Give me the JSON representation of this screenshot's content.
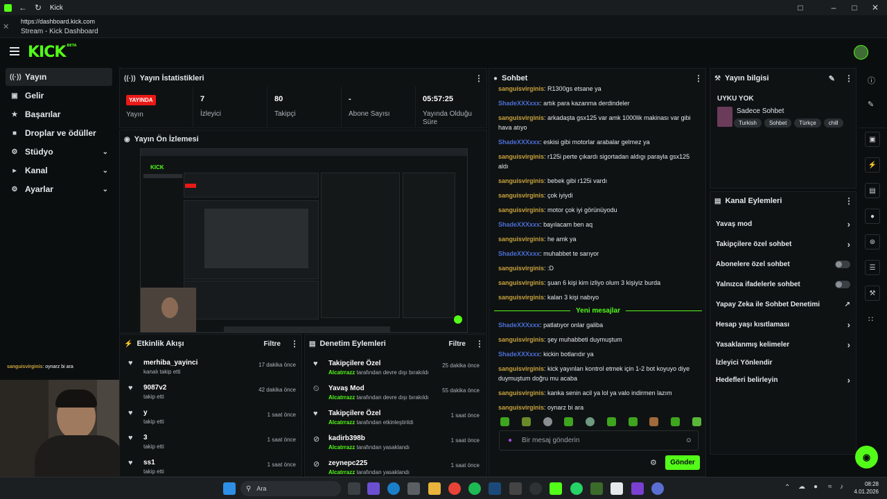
{
  "browser": {
    "tab_title": "Kick",
    "url": "https://dashboard.kick.com",
    "page_title": "Stream - Kick Dashboard"
  },
  "app": {
    "logo_text": "KICK",
    "logo_badge": "BETA"
  },
  "sidebar": {
    "items": [
      {
        "label": "Yayın",
        "icon": "broadcast-icon",
        "active": true
      },
      {
        "label": "Gelir",
        "icon": "wallet-icon"
      },
      {
        "label": "Başarılar",
        "icon": "trophy-icon"
      },
      {
        "label": "Droplar ve ödüller",
        "icon": "gift-icon"
      },
      {
        "label": "Stüdyo",
        "icon": "studio-icon",
        "expandable": true
      },
      {
        "label": "Kanal",
        "icon": "channel-icon",
        "expandable": true
      },
      {
        "label": "Ayarlar",
        "icon": "gear-icon",
        "expandable": true
      }
    ]
  },
  "stats": {
    "title": "Yayın İstatistikleri",
    "live_badge": "YAYINDA",
    "items": [
      {
        "value": "",
        "label": "Yayın"
      },
      {
        "value": "7",
        "label": "İzleyici"
      },
      {
        "value": "80",
        "label": "Takipçi"
      },
      {
        "value": "-",
        "label": "Abone Sayısı"
      },
      {
        "value": "05:57:25",
        "label": "Yayında Olduğu Süre"
      }
    ]
  },
  "preview": {
    "title": "Yayın Ön İzlemesi"
  },
  "activity": {
    "title": "Etkinlik Akışı",
    "filter_label": "Filtre",
    "rows": [
      {
        "name": "merhiba_yayinci",
        "sub": "kanalı takip etti",
        "time": "17 dakika önce"
      },
      {
        "name": "9087v2",
        "sub": "takip etti",
        "time": "42 dakika önce"
      },
      {
        "name": "y",
        "sub": "takip etti",
        "time": "1 saat önce"
      },
      {
        "name": "3",
        "sub": "takip etti",
        "time": "1 saat önce"
      },
      {
        "name": "ss1",
        "sub": "takip etti",
        "time": "1 saat önce"
      }
    ]
  },
  "moderation": {
    "title": "Denetim Eylemleri",
    "filter_label": "Filtre",
    "rows": [
      {
        "title": "Takipçilere Özel",
        "actor": "Alcatrrazz",
        "action": "tarafından devre dışı bırakıldı",
        "time": "25 dakika önce",
        "icon": "heart-icon"
      },
      {
        "title": "Yavaş Mod",
        "actor": "Alcatrrazz",
        "action": "tarafından devre dışı bırakıldı",
        "time": "55 dakika önce",
        "icon": "slow-mode-icon"
      },
      {
        "title": "Takipçilere Özel",
        "actor": "Alcatrrazz",
        "action": "tarafından etkinleştirildi",
        "time": "1 saat önce",
        "icon": "heart-icon"
      },
      {
        "title": "kadirb398b",
        "actor": "Alcatrrazz",
        "action": "tarafından yasaklandı",
        "time": "1 saat önce",
        "icon": "ban-icon"
      },
      {
        "title": "zeynepc225",
        "actor": "Alcatrrazz",
        "action": "tarafından yasaklandı",
        "time": "1 saat önce",
        "icon": "ban-icon"
      }
    ]
  },
  "chat": {
    "title": "Sohbet",
    "messages": [
      {
        "user": "sanguisvirginis",
        "color": "green",
        "text": "R1300gs etsane ya"
      },
      {
        "user": "ShadeXXXxxx",
        "color": "blue",
        "text": "artık para kazanma derdindeler"
      },
      {
        "user": "sanguisvirginis",
        "color": "green",
        "text": "arkadaşta gsx125 var amk 1000lik makinası var gibi hava atıyo"
      },
      {
        "user": "ShadeXXXxxx",
        "color": "blue",
        "text": "eskisi gibi motorlar arabalar gelmez ya"
      },
      {
        "user": "sanguisvirginis",
        "color": "green",
        "text": "r125i perte çıkardı sigortadan aldıgı parayla gsx125 aldı"
      },
      {
        "user": "sanguisvirginis",
        "color": "green",
        "text": "bebek gibi r125i vardı"
      },
      {
        "user": "sanguisvirginis",
        "color": "green",
        "text": "çok iyiydi"
      },
      {
        "user": "sanguisvirginis",
        "color": "green",
        "text": "motor çok iyi görünüyodu"
      },
      {
        "user": "ShadeXXXxxx",
        "color": "blue",
        "text": "bayılacam ben aq"
      },
      {
        "user": "sanguisvirginis",
        "color": "green",
        "text": "he amk ya"
      },
      {
        "user": "ShadeXXXxxx",
        "color": "blue",
        "text": "muhabbet te sarıyor"
      },
      {
        "user": "sanguisvirginis",
        "color": "green",
        "text": ":D"
      },
      {
        "user": "sanguisvirginis",
        "color": "green",
        "text": "şuan 6 kişi kim izliyo olum 3 kişiyiz burda"
      },
      {
        "user": "sanguisvirginis",
        "color": "green",
        "text": "kalan 3 kişi nabıyo"
      }
    ],
    "new_messages_label": "Yeni mesajlar",
    "new_messages": [
      {
        "user": "ShadeXXXxxx",
        "color": "blue",
        "text": "patlatıyor onlar galiba"
      },
      {
        "user": "sanguisvirginis",
        "color": "green",
        "text": "şey muhabbeti duymuştum"
      },
      {
        "user": "ShadeXXXxxx",
        "color": "blue",
        "text": "kickin botlarıdır ya"
      },
      {
        "user": "sanguisvirginis",
        "color": "green",
        "text": "kick yayınları kontrol etmek için 1-2 bot koyuyo diye duymuştum doğru mu acaba"
      },
      {
        "user": "sanguisvirginis",
        "color": "green",
        "text": "kanka senin acil ya lol ya valo indirmen lazım"
      },
      {
        "user": "sanguisvirginis",
        "color": "green",
        "text": "oynarz bi ara"
      }
    ],
    "input_placeholder": "Bir mesaj gönderin",
    "send_label": "Gönder"
  },
  "stream_info": {
    "title": "Yayın bilgisi",
    "stream_title": "UYKU YOK",
    "category": "Sadece Sohbet",
    "tags": [
      "Turkish",
      "Sohbet",
      "Türkçe",
      "chill"
    ]
  },
  "channel_actions": {
    "title": "Kanal Eylemleri",
    "items": [
      {
        "label": "Yavaş mod",
        "control": "chevron"
      },
      {
        "label": "Takipçilere özel sohbet",
        "control": "chevron"
      },
      {
        "label": "Abonelere özel sohbet",
        "control": "toggle"
      },
      {
        "label": "Yalnızca ifadelerle sohbet",
        "control": "toggle"
      },
      {
        "label": "Yapay Zeka ile Sohbet Denetimi",
        "control": "external"
      },
      {
        "label": "Hesap yaşı kısıtlaması",
        "control": "chevron"
      },
      {
        "label": "Yasaklanmış kelimeler",
        "control": "chevron"
      },
      {
        "label": "İzleyici Yönlendir",
        "control": "none"
      },
      {
        "label": "Hedefleri belirleyin",
        "control": "chevron"
      }
    ]
  },
  "overlay": {
    "webcam_chat_user": "sanguisvirginis",
    "webcam_chat_text": "oynarz bi ara"
  },
  "taskbar": {
    "search_label": "Ara",
    "time": "08:28",
    "date": "4.01.2026"
  },
  "colors": {
    "brand": "#53fc18",
    "live": "#e91916",
    "user_green": "#c8a33e",
    "user_blue": "#4b6fd6"
  }
}
